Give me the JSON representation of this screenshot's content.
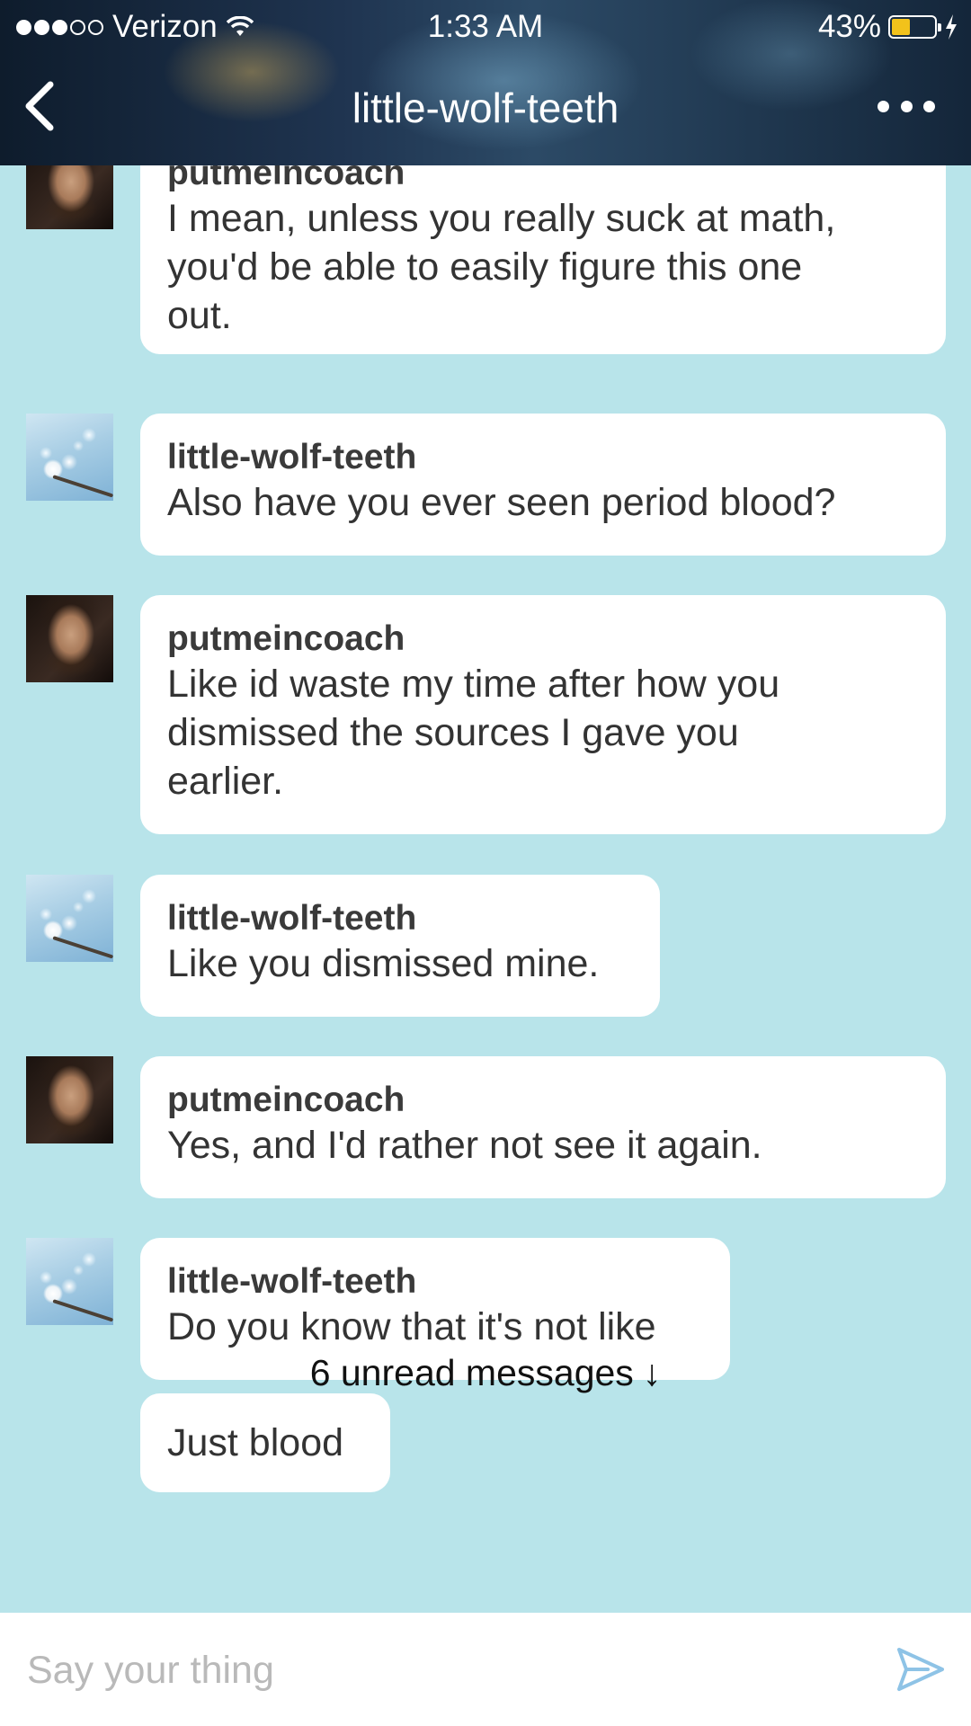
{
  "status_bar": {
    "carrier": "Verizon",
    "time": "1:33 AM",
    "battery": "43%",
    "battery_level": 0.43,
    "battery_color": "#f2c21b"
  },
  "header": {
    "title": "little-wolf-teeth",
    "back_icon": "chevron-left-icon",
    "more_icon": "more-dots-icon"
  },
  "messages": [
    {
      "sender": "putmeincoach",
      "lines": [
        "I mean, unless you really suck at math,",
        "you'd be able to easily figure this one",
        "out."
      ],
      "avatar": "man"
    },
    {
      "sender": "little-wolf-teeth",
      "lines": [
        "Also have you ever seen period blood?"
      ],
      "avatar": "flower"
    },
    {
      "sender": "putmeincoach",
      "lines": [
        "Like id waste my time after how you",
        "dismissed the sources I gave you",
        "earlier."
      ],
      "avatar": "man"
    },
    {
      "sender": "little-wolf-teeth",
      "lines": [
        "Like you dismissed mine."
      ],
      "avatar": "flower"
    },
    {
      "sender": "putmeincoach",
      "lines": [
        "Yes, and I'd rather not see it again."
      ],
      "avatar": "man"
    },
    {
      "sender": "little-wolf-teeth",
      "lines": [
        "Do you know that it's not like"
      ],
      "avatar": "flower"
    },
    {
      "sender": "",
      "lines": [
        "Just blood"
      ],
      "avatar": ""
    }
  ],
  "unread": {
    "label": "6 unread messages",
    "arrow": "↓"
  },
  "composer": {
    "placeholder": "Say your thing",
    "send_icon": "send-icon"
  },
  "colors": {
    "chat_background": "#b8e4ea",
    "bubble": "#ffffff",
    "send_accent": "#8ec3e6"
  }
}
